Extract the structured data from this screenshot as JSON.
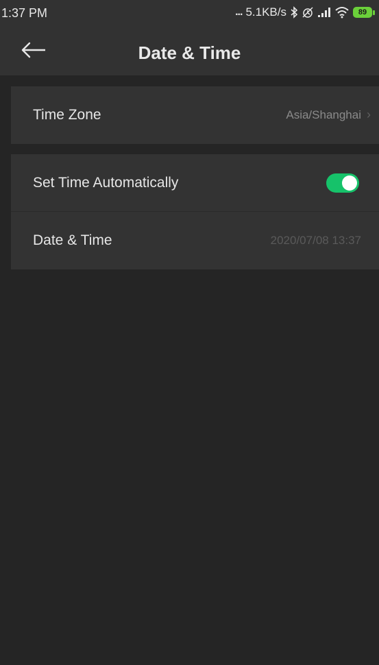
{
  "status_bar": {
    "time": "1:37 PM",
    "dots": "...",
    "network_speed": "5.1KB/s",
    "battery_level": "89",
    "icons": [
      "bluetooth-icon",
      "alarm-off-icon",
      "signal-icon",
      "wifi-icon",
      "battery-icon"
    ]
  },
  "header": {
    "title": "Date & Time",
    "back_icon": "arrow-left-icon"
  },
  "settings": {
    "time_zone": {
      "label": "Time Zone",
      "value": "Asia/Shanghai",
      "icon": "chevron-right-icon"
    },
    "set_time_automatically": {
      "label": "Set Time Automatically",
      "enabled": true
    },
    "date_time": {
      "label": "Date & Time",
      "value": "2020/07/08 13:37"
    }
  },
  "colors": {
    "background": "#252525",
    "row": "#333333",
    "toggle_on": "#16c26a",
    "battery": "#6bd03a"
  }
}
